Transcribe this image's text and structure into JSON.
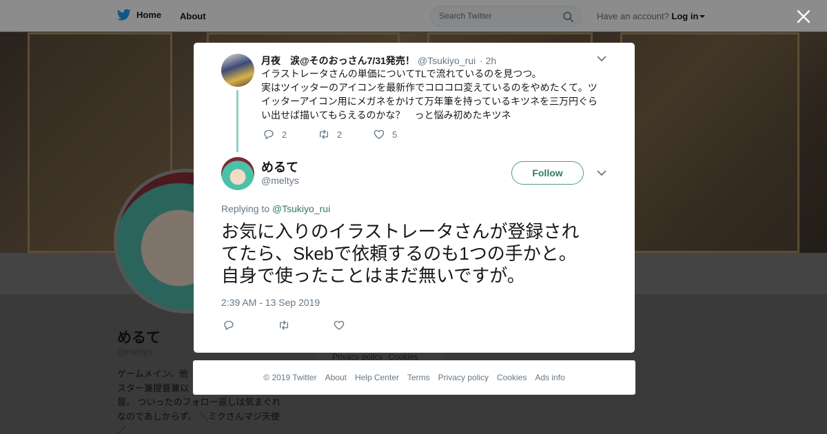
{
  "topbar": {
    "home_label": "Home",
    "about_label": "About",
    "search_placeholder": "Search Twitter",
    "account_prompt": "Have an account?",
    "login_label": "Log in"
  },
  "profile": {
    "name": "めるて",
    "handle": "@meltys",
    "bio": "ゲームメイン、他\nスター兼提督兼以\n督。 ついったのフォロー返しは気まぐれ\nなのであしからず。 ＼ミクさんマジ天使\n／"
  },
  "background_links": [
    "Privacy policy",
    "Cookies"
  ],
  "parent_tweet": {
    "name": "月夜　涙@そのおっさん7/31発売！",
    "handle": "@Tsukiyo_rui",
    "time": "· 2h",
    "text": "イラストレータさんの単価についてTLで流れているのを見つつ。\n実はツイッターのアイコンを最新作でコロコロ変えているのをやめたくて。ツイッターアイコン用にメガネをかけて万年筆を持っているキツネを三万円ぐらい出せば描いてもらえるのかな？　っと悩み初めたキツネ",
    "reply_count": "2",
    "retweet_count": "2",
    "like_count": "5"
  },
  "main_tweet": {
    "name": "めるて",
    "handle": "@meltys",
    "follow_label": "Follow",
    "replying_prefix": "Replying to",
    "replying_to": "@Tsukiyo_rui",
    "text": "お気に入りのイラストレータさんが登録されてたら、Skebで依頼するのも1つの手かと。自身で使ったことはまだ無いですが。",
    "timestamp": "2:39 AM - 13 Sep 2019"
  },
  "footer": {
    "links": [
      "© 2019 Twitter",
      "About",
      "Help Center",
      "Terms",
      "Privacy policy",
      "Cookies",
      "Ads info"
    ]
  },
  "icons": {
    "logo": "twitter-bird-icon",
    "search": "magnifier-icon",
    "close": "close-icon",
    "reply": "reply-icon",
    "retweet": "retweet-icon",
    "like": "heart-icon",
    "menu": "chevron-down-icon"
  },
  "colors": {
    "brand_blue": "#1da1f2",
    "follow_accent": "#2f7a63",
    "thread_line": "#8fd0c4",
    "muted_text": "#657786"
  }
}
